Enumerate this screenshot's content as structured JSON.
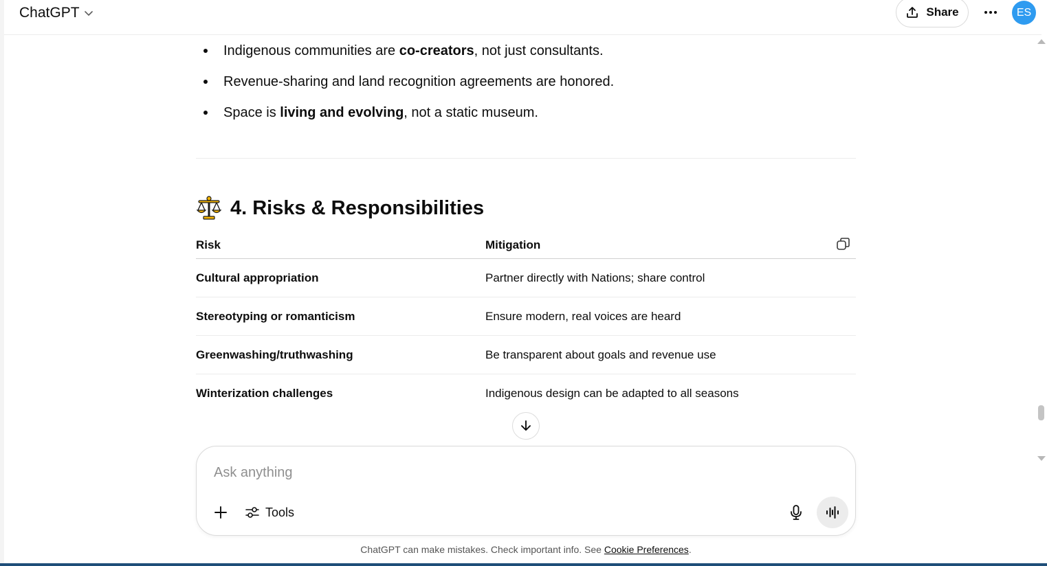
{
  "header": {
    "model_name": "ChatGPT",
    "share_label": "Share",
    "avatar_initials": "ES"
  },
  "bullets": [
    {
      "pre": "Indigenous communities are ",
      "bold": "co-creators",
      "post": ", not just consultants."
    },
    {
      "pre": "Revenue-sharing and land recognition agreements are honored.",
      "bold": "",
      "post": ""
    },
    {
      "pre": "Space is ",
      "bold": "living and evolving",
      "post": ", not a static museum."
    }
  ],
  "section": {
    "heading": "4. Risks & Responsibilities",
    "icon": "balance-scale-icon"
  },
  "table": {
    "headers": [
      "Risk",
      "Mitigation"
    ],
    "rows": [
      {
        "risk": "Cultural appropriation",
        "mitigation": "Partner directly with Nations; share control"
      },
      {
        "risk": "Stereotyping or romanticism",
        "mitigation": "Ensure modern, real voices are heard"
      },
      {
        "risk": "Greenwashing/truthwashing",
        "mitigation": "Be transparent about goals and revenue use"
      },
      {
        "risk": "Winterization challenges",
        "mitigation": "Indigenous design can be adapted to all seasons"
      }
    ]
  },
  "composer": {
    "placeholder": "Ask anything",
    "value": "",
    "tools_label": "Tools"
  },
  "footer": {
    "text": "ChatGPT can make mistakes. Check important info. See ",
    "link": "Cookie Preferences",
    "suffix": "."
  },
  "colors": {
    "avatar": "#2e9bf0",
    "text": "#0d0d0d",
    "bottom_bar": "#1f4e79"
  }
}
